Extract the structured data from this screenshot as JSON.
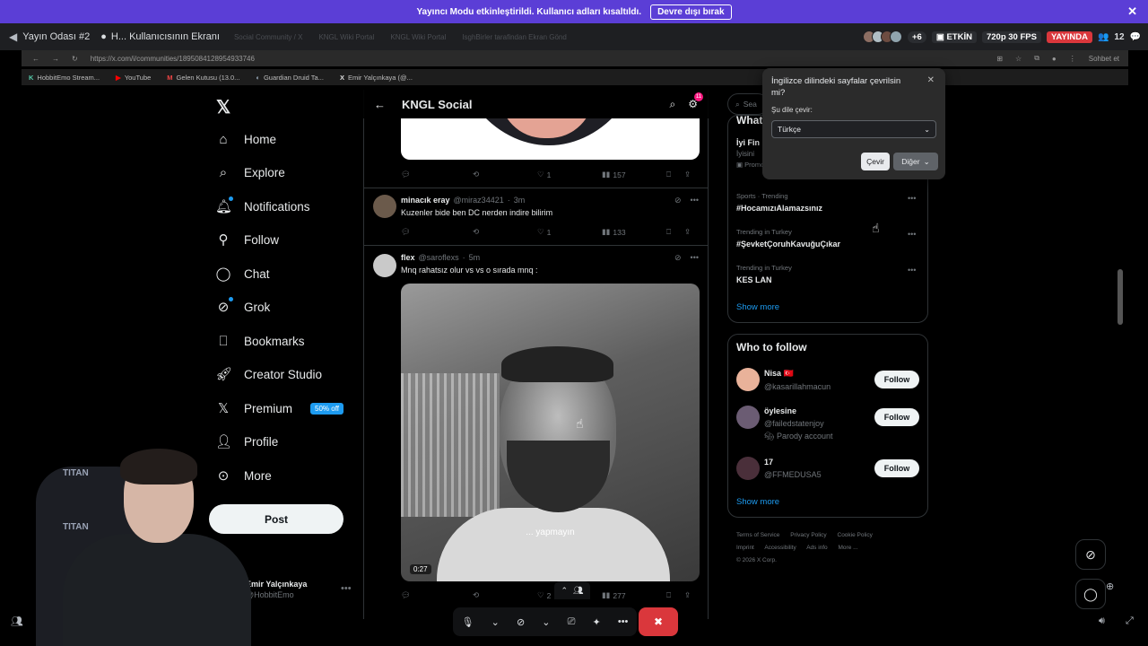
{
  "banner": {
    "message": "Yayıncı Modu etkinleştirildi. Kullanıcı adları kısaltıldı.",
    "disable_label": "Devre dışı bırak"
  },
  "call_bar": {
    "room_name": "Yayın Odası #2",
    "stream_title": "H... Kullanıcısının Ekranı",
    "ghost_tabs": [
      "Social Community / X",
      "KNGL Wiki Portal",
      "KNGL Wiki Portal",
      "IsghBirler tarafindan Ekran Gönd"
    ],
    "viewer_extra": "+6",
    "status_on": "ETKİN",
    "quality": "720p 30 FPS",
    "live": "YAYINDA",
    "viewer_count": "12"
  },
  "browser": {
    "url": "https://x.com/i/communities/1895084128954933746",
    "chat_label": "Sohbet et",
    "bookmarks": [
      "HobbitEmo Stream...",
      "YouTube",
      "Gelen Kutusu (13.0...",
      "Guardian Druid Ta...",
      "Emir Yalçınkaya (@..."
    ]
  },
  "sidebar": {
    "items": [
      {
        "label": "Home",
        "icon": "home-icon"
      },
      {
        "label": "Explore",
        "icon": "search-icon"
      },
      {
        "label": "Notifications",
        "icon": "bell-icon"
      },
      {
        "label": "Follow",
        "icon": "person-plus-icon"
      },
      {
        "label": "Chat",
        "icon": "chat-bubble-icon"
      },
      {
        "label": "Grok",
        "icon": "grok-icon"
      },
      {
        "label": "Bookmarks",
        "icon": "bookmark-icon"
      },
      {
        "label": "Creator Studio",
        "icon": "rocket-icon"
      },
      {
        "label": "Premium",
        "icon": "x-logo-icon"
      },
      {
        "label": "Profile",
        "icon": "person-icon"
      },
      {
        "label": "More",
        "icon": "more-circle-icon"
      }
    ],
    "premium_badge": "50% off",
    "post_label": "Post",
    "account_name": "Emir Yalçınkaya",
    "account_handle": "@HobbitEmo"
  },
  "feed": {
    "title": "KNGL Social",
    "header_badge": "11",
    "top_post_actions": {
      "replies": "",
      "reposts": "",
      "likes": "1",
      "views": "157"
    },
    "tweets": [
      {
        "name": "minacık eray",
        "handle": "@miraz34421",
        "time": "3m",
        "text": "Kuzenler bide ben DC nerden indire bilirim",
        "likes": "1",
        "views": "133"
      },
      {
        "name": "flex",
        "handle": "@saroflexs",
        "time": "5m",
        "text": "Mnq rahatsız olur vs vs o sırada mnq :",
        "video_caption": "... yapmayın",
        "video_time": "0:27",
        "likes": "2",
        "views": "277"
      }
    ]
  },
  "right": {
    "search_placeholder": "Sea",
    "whats_happening": "What's happening",
    "trends": [
      {
        "meta": "",
        "title": "İyi Fin",
        "sub": "İyisini",
        "promo": "Promoted"
      },
      {
        "meta": "Sports · Trending",
        "title": "#HocamızıAlamazsınız"
      },
      {
        "meta": "Trending in Turkey",
        "title": "#ŞevketÇoruhKavuğuÇıkar"
      },
      {
        "meta": "Trending in Turkey",
        "title": "KES LAN"
      }
    ],
    "show_more": "Show more",
    "who_to_follow": "Who to follow",
    "follow_suggestions": [
      {
        "name": "Nisa 🇹🇷",
        "handle": "@kasarillahmacun",
        "extra": ""
      },
      {
        "name": "öylesine",
        "handle": "@failedstatenjoy",
        "extra": "Parody account"
      },
      {
        "name": "17",
        "handle": "@FFMEDUSA5",
        "extra": ""
      }
    ],
    "follow_label": "Follow",
    "footer": [
      "Terms of Service",
      "Privacy Policy",
      "Cookie Policy",
      "Imprint",
      "Accessibility",
      "Ads info",
      "More ...",
      "© 2026 X Corp."
    ]
  },
  "translate_popup": {
    "question": "İngilizce dilindeki sayfalar çevrilsin mi?",
    "label": "Şu dile çevir:",
    "selected_language": "Türkçe",
    "translate_label": "Çevir",
    "other_label": "Diğer"
  },
  "webcam": {
    "chair_text": "TITAN"
  },
  "colors": {
    "banner": "#5b3ed6",
    "accent": "#1d9bf0",
    "live": "#da373c",
    "notification_badge": "#f91880"
  }
}
